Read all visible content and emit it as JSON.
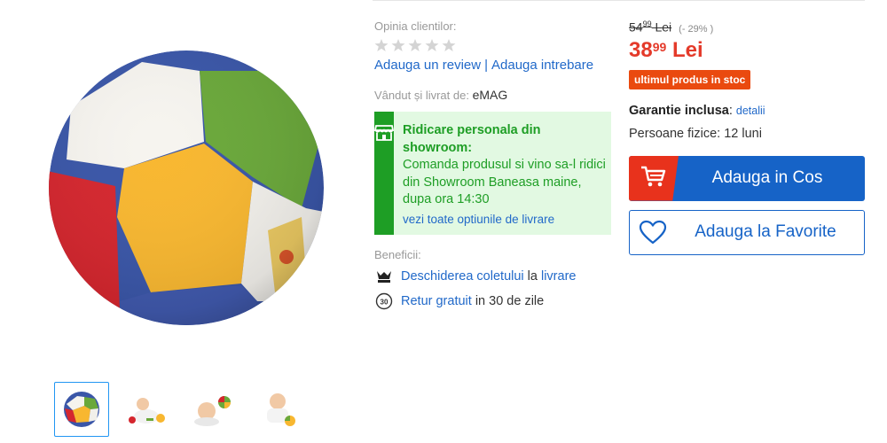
{
  "rating": {
    "label": "Opinia clientilor:",
    "stars_filled": 0,
    "stars_total": 5,
    "add_review": "Adauga un review",
    "separator": "|",
    "add_question": "Adauga intrebare"
  },
  "seller": {
    "label": "Vândut și livrat de:",
    "name": "eMAG"
  },
  "pickup": {
    "icon": "store-icon",
    "title": "Ridicare personala din showroom:",
    "text": "Comanda produsul si vino sa-l ridici din Showroom Baneasa maine, dupa ora 14:30",
    "link": "vezi toate optiunile de livrare"
  },
  "benefits": {
    "label": "Beneficii:",
    "items": [
      {
        "icon": "box-open-icon",
        "link": "Deschiderea coletului",
        "mid": " la ",
        "link2": "livrare",
        "rest": ""
      },
      {
        "icon": "return-30-icon",
        "link": "Retur gratuit",
        "mid": " in 30 de zile",
        "link2": "",
        "rest": ""
      }
    ]
  },
  "price": {
    "old_int": "54",
    "old_dec": "99",
    "old_currency": "Lei",
    "discount": "(- 29% )",
    "new_int": "38",
    "new_dec": "99",
    "new_currency": "Lei",
    "stock_badge": "ultimul produs in stoc"
  },
  "warranty": {
    "label": "Garantie inclusa",
    "colon": ":",
    "link": "detalii",
    "persons": "Persoane fizice: 12 luni"
  },
  "buttons": {
    "cart": "Adauga in Cos",
    "favorite": "Adauga la Favorite"
  },
  "gallery": {
    "thumbnail_count": 4,
    "active_index": 0
  },
  "colors": {
    "link": "#2169c9",
    "price_red": "#e43a2a",
    "stock_orange": "#ea4a0f",
    "pickup_green": "#1e9e25",
    "pickup_bg": "#e2f9e2",
    "button_blue": "#1663c7",
    "cart_red": "#e8321c"
  }
}
